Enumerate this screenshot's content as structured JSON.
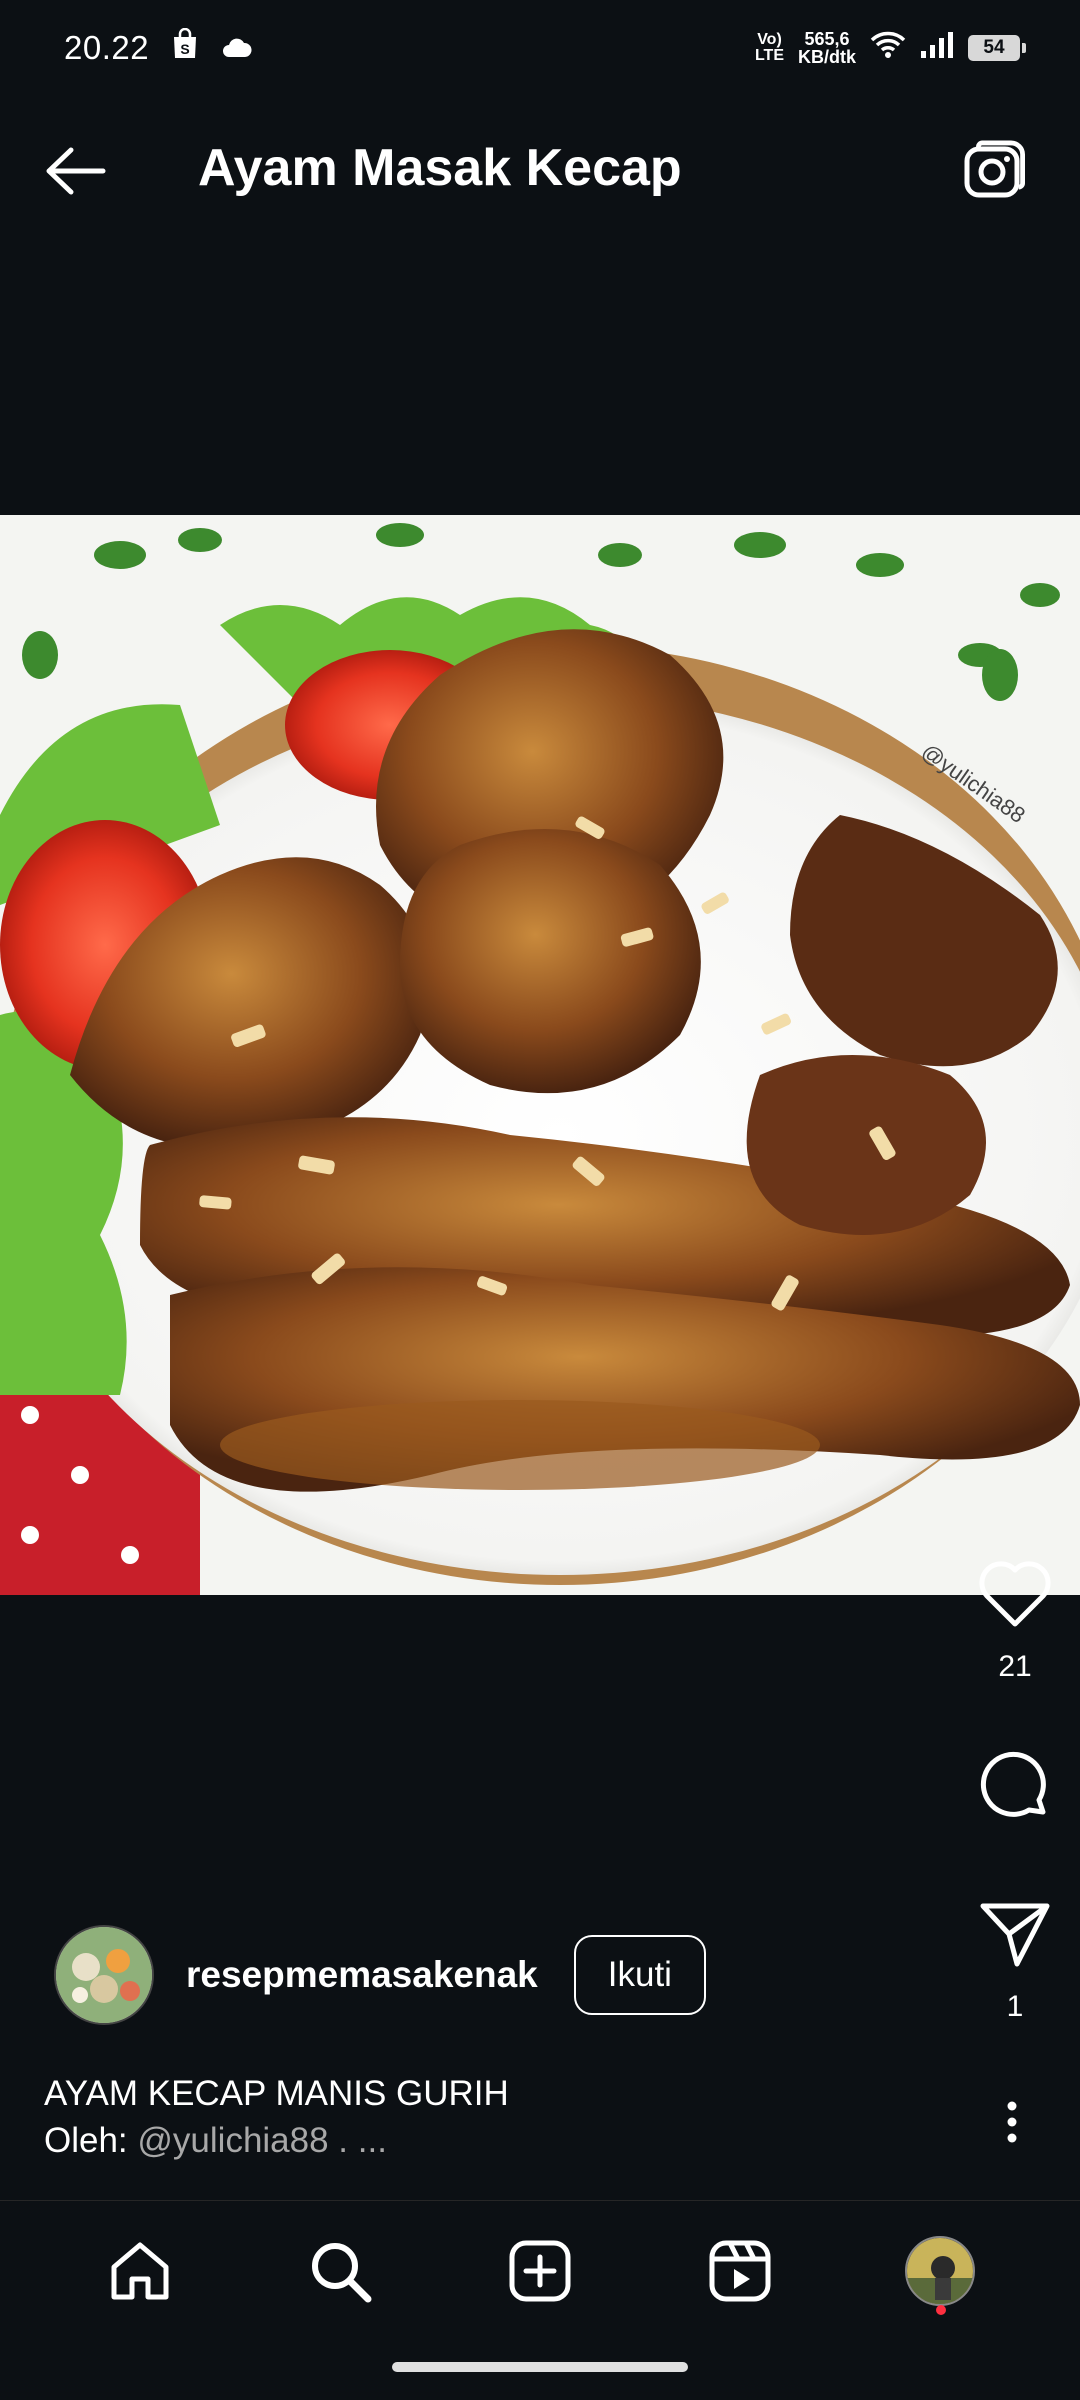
{
  "status_bar": {
    "time": "20.22",
    "lte_line1": "Vo)",
    "lte_line2": "LTE",
    "speed_line1": "565,6",
    "speed_line2": "KB/dtk",
    "battery": "54"
  },
  "header": {
    "title": "Ayam Masak Kecap"
  },
  "post": {
    "image_watermark": "@yulichia88",
    "likes": "21",
    "shares": "1",
    "author": "resepmemasakenak",
    "follow_label": "Ikuti",
    "caption_line1": "AYAM KECAP MANIS GURIH",
    "caption_prefix": "Oleh: ",
    "caption_handle": "@yulichia88",
    "caption_suffix": " . ..."
  },
  "colors": {
    "background": "#0c1014",
    "text": "#ffffff",
    "muted": "#a8a8a8",
    "notification": "#ff3040"
  },
  "icons": {
    "back": "arrow-left-icon",
    "camera": "camera-icon",
    "like": "heart-icon",
    "comment": "comment-icon",
    "share": "send-icon",
    "more": "more-vertical-icon",
    "home": "home-icon",
    "search": "search-icon",
    "create": "plus-square-icon",
    "reels": "reels-icon"
  }
}
